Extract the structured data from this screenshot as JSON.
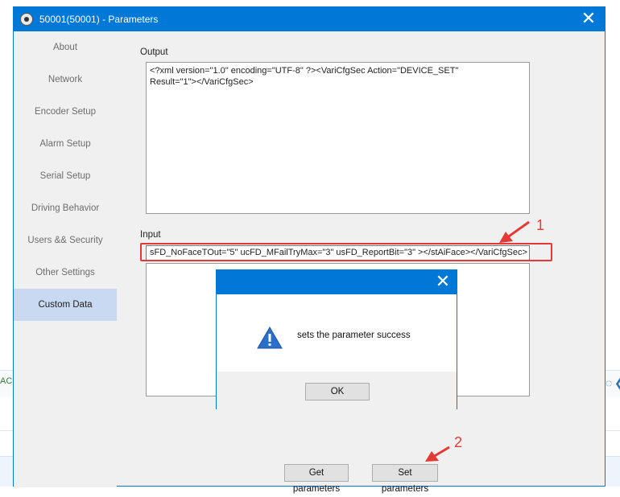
{
  "window": {
    "title": "50001(50001) - Parameters",
    "close_glyph": "✕"
  },
  "sidebar": {
    "items": [
      {
        "label": "About"
      },
      {
        "label": "Network"
      },
      {
        "label": "Encoder Setup"
      },
      {
        "label": "Alarm Setup"
      },
      {
        "label": "Serial Setup"
      },
      {
        "label": "Driving Behavior"
      },
      {
        "label": "Users && Security"
      },
      {
        "label": "Other Settings"
      },
      {
        "label": "Custom Data"
      }
    ],
    "active_index": 8
  },
  "output": {
    "label": "Output",
    "text": "<?xml version=\"1.0\" encoding=\"UTF-8\" ?><VariCfgSec Action=\"DEVICE_SET\"\nResult=\"1\"></VariCfgSec>"
  },
  "input": {
    "label": "Input",
    "value": "sFD_NoFaceTOut=\"5\" ucFD_MFailTryMax=\"3\" usFD_ReportBit=\"3\" ></stAiFace></VariCfgSec>"
  },
  "buttons": {
    "get": "Get parameters",
    "set": "Set parameters"
  },
  "dialog": {
    "message": "sets the parameter success",
    "ok": "OK",
    "close_glyph": "✕",
    "icon": "warning-icon"
  },
  "annotations": {
    "one": "1",
    "two": "2"
  },
  "colors": {
    "accent": "#0078d7",
    "annotation": "#e53935",
    "active_tab": "#c8d9f1"
  },
  "background": {
    "left_fragment": "AC"
  }
}
